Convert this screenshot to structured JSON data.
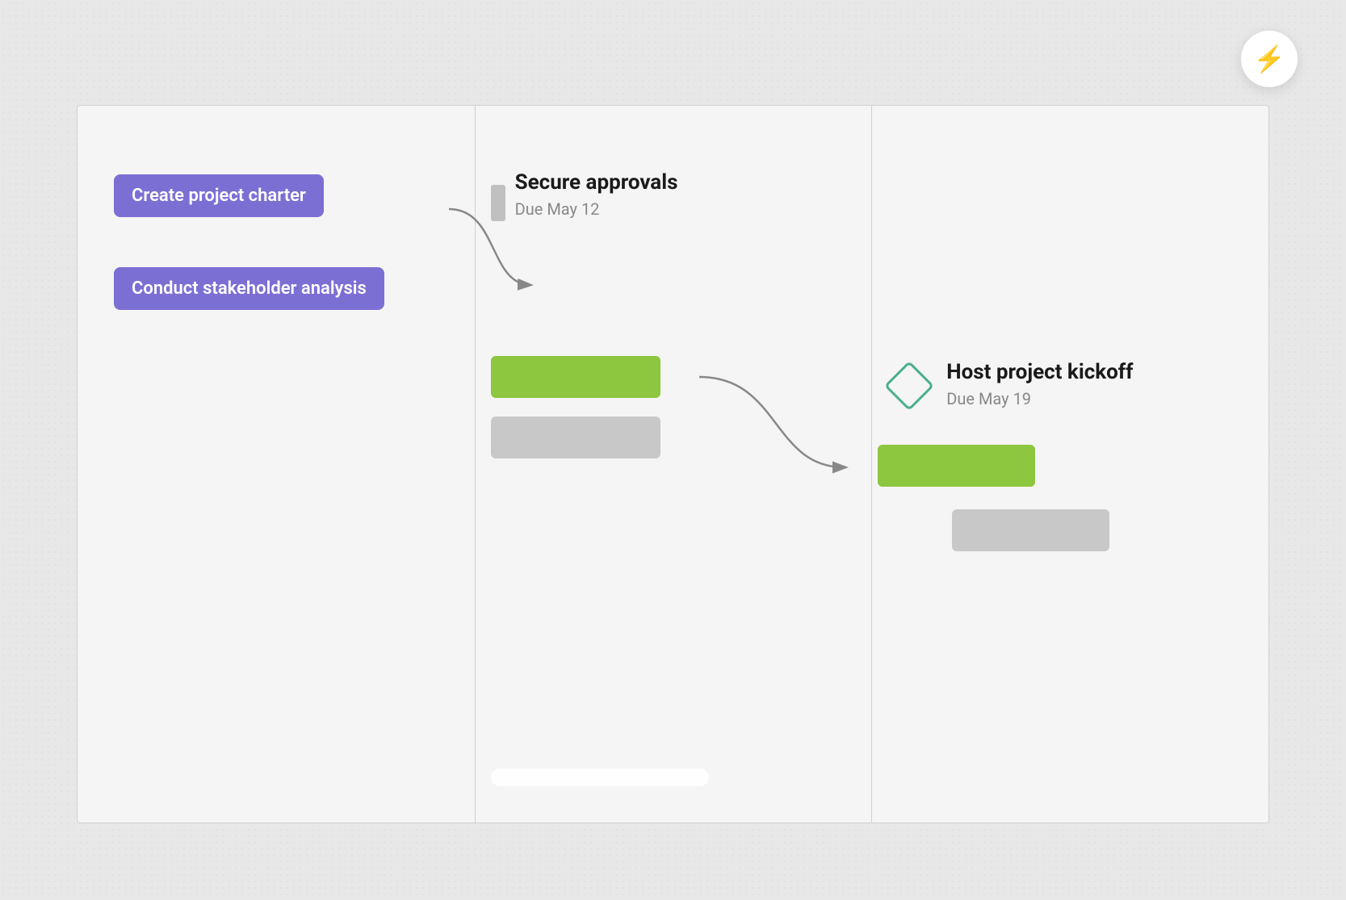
{
  "lightning_button": {
    "label": "⚡",
    "aria": "Quick actions"
  },
  "gantt": {
    "tasks": [
      {
        "id": "task-1",
        "label": "Create project charter",
        "color": "#7c6fd4",
        "row": 1
      },
      {
        "id": "task-2",
        "label": "Conduct stakeholder analysis",
        "color": "#7c6fd4",
        "row": 2
      }
    ],
    "milestones": [
      {
        "id": "milestone-1",
        "title": "Secure approvals",
        "due": "Due May 12"
      },
      {
        "id": "milestone-2",
        "title": "Host project kickoff",
        "due": "Due May 19"
      }
    ],
    "bars": [
      {
        "id": "green-bar-1",
        "color": "green"
      },
      {
        "id": "green-bar-2",
        "color": "green"
      },
      {
        "id": "gray-bar-1",
        "color": "gray"
      },
      {
        "id": "gray-bar-2",
        "color": "gray"
      }
    ]
  }
}
